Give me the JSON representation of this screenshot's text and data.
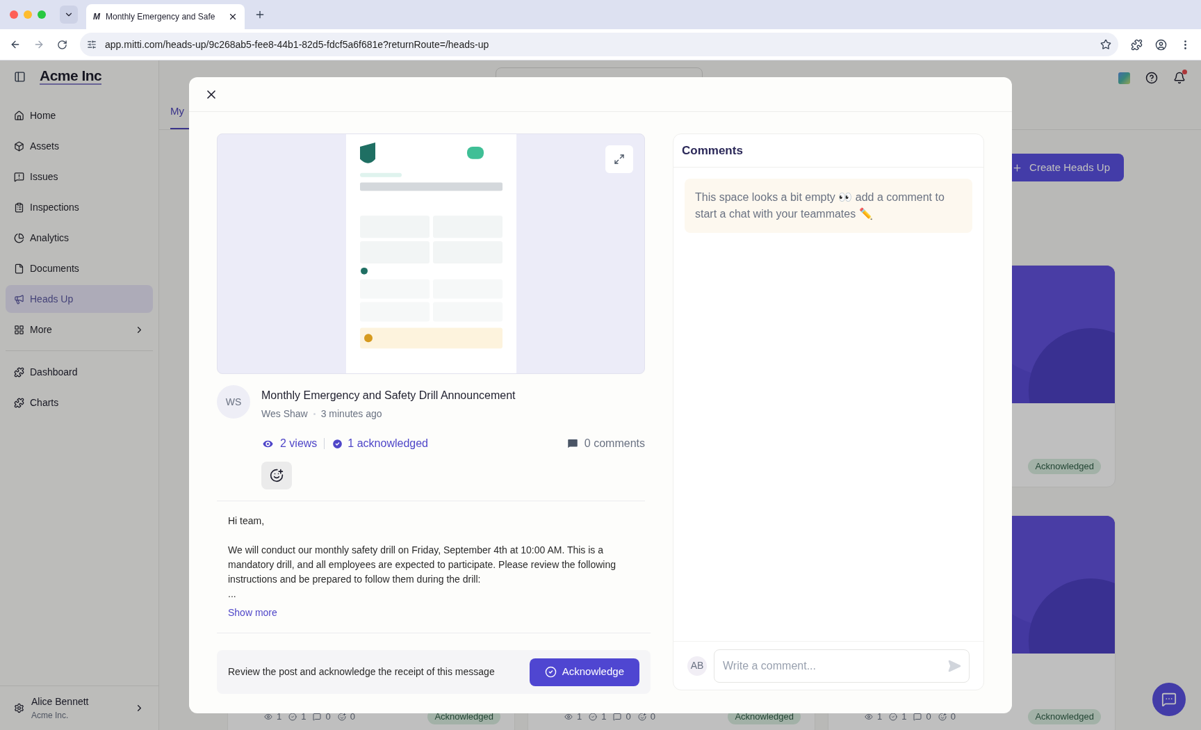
{
  "browser": {
    "tab": {
      "favicon": "M",
      "title": "Monthly Emergency and Safe"
    },
    "url": "app.mitti.com/heads-up/9c268ab5-fee8-44b1-82d5-fdcf5a6f681e?returnRoute=/heads-up"
  },
  "sidebar": {
    "logo": "Acme Inc",
    "items": [
      {
        "label": "Home",
        "kind": "link",
        "selected": false
      },
      {
        "label": "Assets",
        "kind": "link",
        "selected": false
      },
      {
        "label": "Issues",
        "kind": "link",
        "selected": false
      },
      {
        "label": "Inspections",
        "kind": "link",
        "selected": false
      },
      {
        "label": "Analytics",
        "kind": "link",
        "selected": false
      },
      {
        "label": "Documents",
        "kind": "link",
        "selected": false
      },
      {
        "label": "Heads Up",
        "kind": "link",
        "selected": true
      },
      {
        "label": "More",
        "kind": "menu",
        "selected": false
      }
    ],
    "secondary": [
      {
        "label": "Dashboard"
      },
      {
        "label": "Charts"
      }
    ],
    "user": {
      "name": "Alice Bennett",
      "org": "Acme Inc."
    }
  },
  "page": {
    "tabs": [
      {
        "label": "My",
        "selected": true
      }
    ],
    "create_button": "Create Heads Up",
    "cards": [
      {
        "media": {
          "kind": "picture"
        },
        "badge": "Acknowledged"
      },
      {
        "stats": [
          "1",
          "1",
          "0",
          "0"
        ],
        "badge": "Acknowledged"
      },
      {
        "stats": [
          "1",
          "1",
          "0",
          "0"
        ],
        "badge": "Acknowledged"
      },
      {
        "media": {
          "kind": "picture"
        },
        "stats": [
          "1",
          "1",
          "0",
          "0"
        ],
        "badge": "Acknowledged"
      }
    ]
  },
  "modal": {
    "attachment": {
      "kind": "picture"
    },
    "post": {
      "avatar": "WS",
      "title": "Monthly Emergency and Safety Drill Announcement",
      "author": "Wes Shaw",
      "time": "3 minutes ago",
      "views": "2 views",
      "acknowledged": "1 acknowledged",
      "comments": "0 comments"
    },
    "body": [
      "Hi team,",
      "We will conduct our monthly safety drill on Friday, September 4th at 10:00 AM. This is a mandatory drill, and all employees are expected to participate. Please review the following instructions and be prepared to follow them during the drill:",
      "..."
    ],
    "show_more": "Show more",
    "acknowledge_bar": {
      "text": "Review the post and acknowledge the receipt of this message",
      "button": "Acknowledge"
    },
    "comments": {
      "title": "Comments",
      "empty_message": "This space looks a bit empty 👀 add a comment to start a chat with your teammates ✏️",
      "avatar": "AB",
      "placeholder": "Write a comment..."
    }
  }
}
